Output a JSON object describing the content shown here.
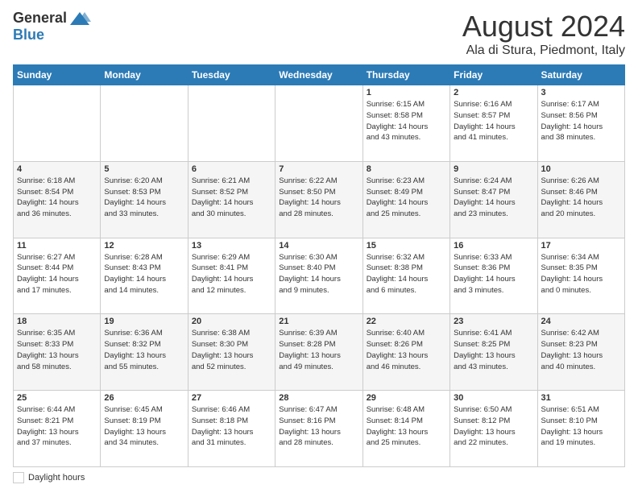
{
  "header": {
    "logo_general": "General",
    "logo_blue": "Blue",
    "month_title": "August 2024",
    "location": "Ala di Stura, Piedmont, Italy"
  },
  "calendar": {
    "headers": [
      "Sunday",
      "Monday",
      "Tuesday",
      "Wednesday",
      "Thursday",
      "Friday",
      "Saturday"
    ],
    "weeks": [
      [
        {
          "day": "",
          "info": ""
        },
        {
          "day": "",
          "info": ""
        },
        {
          "day": "",
          "info": ""
        },
        {
          "day": "",
          "info": ""
        },
        {
          "day": "1",
          "info": "Sunrise: 6:15 AM\nSunset: 8:58 PM\nDaylight: 14 hours\nand 43 minutes."
        },
        {
          "day": "2",
          "info": "Sunrise: 6:16 AM\nSunset: 8:57 PM\nDaylight: 14 hours\nand 41 minutes."
        },
        {
          "day": "3",
          "info": "Sunrise: 6:17 AM\nSunset: 8:56 PM\nDaylight: 14 hours\nand 38 minutes."
        }
      ],
      [
        {
          "day": "4",
          "info": "Sunrise: 6:18 AM\nSunset: 8:54 PM\nDaylight: 14 hours\nand 36 minutes."
        },
        {
          "day": "5",
          "info": "Sunrise: 6:20 AM\nSunset: 8:53 PM\nDaylight: 14 hours\nand 33 minutes."
        },
        {
          "day": "6",
          "info": "Sunrise: 6:21 AM\nSunset: 8:52 PM\nDaylight: 14 hours\nand 30 minutes."
        },
        {
          "day": "7",
          "info": "Sunrise: 6:22 AM\nSunset: 8:50 PM\nDaylight: 14 hours\nand 28 minutes."
        },
        {
          "day": "8",
          "info": "Sunrise: 6:23 AM\nSunset: 8:49 PM\nDaylight: 14 hours\nand 25 minutes."
        },
        {
          "day": "9",
          "info": "Sunrise: 6:24 AM\nSunset: 8:47 PM\nDaylight: 14 hours\nand 23 minutes."
        },
        {
          "day": "10",
          "info": "Sunrise: 6:26 AM\nSunset: 8:46 PM\nDaylight: 14 hours\nand 20 minutes."
        }
      ],
      [
        {
          "day": "11",
          "info": "Sunrise: 6:27 AM\nSunset: 8:44 PM\nDaylight: 14 hours\nand 17 minutes."
        },
        {
          "day": "12",
          "info": "Sunrise: 6:28 AM\nSunset: 8:43 PM\nDaylight: 14 hours\nand 14 minutes."
        },
        {
          "day": "13",
          "info": "Sunrise: 6:29 AM\nSunset: 8:41 PM\nDaylight: 14 hours\nand 12 minutes."
        },
        {
          "day": "14",
          "info": "Sunrise: 6:30 AM\nSunset: 8:40 PM\nDaylight: 14 hours\nand 9 minutes."
        },
        {
          "day": "15",
          "info": "Sunrise: 6:32 AM\nSunset: 8:38 PM\nDaylight: 14 hours\nand 6 minutes."
        },
        {
          "day": "16",
          "info": "Sunrise: 6:33 AM\nSunset: 8:36 PM\nDaylight: 14 hours\nand 3 minutes."
        },
        {
          "day": "17",
          "info": "Sunrise: 6:34 AM\nSunset: 8:35 PM\nDaylight: 14 hours\nand 0 minutes."
        }
      ],
      [
        {
          "day": "18",
          "info": "Sunrise: 6:35 AM\nSunset: 8:33 PM\nDaylight: 13 hours\nand 58 minutes."
        },
        {
          "day": "19",
          "info": "Sunrise: 6:36 AM\nSunset: 8:32 PM\nDaylight: 13 hours\nand 55 minutes."
        },
        {
          "day": "20",
          "info": "Sunrise: 6:38 AM\nSunset: 8:30 PM\nDaylight: 13 hours\nand 52 minutes."
        },
        {
          "day": "21",
          "info": "Sunrise: 6:39 AM\nSunset: 8:28 PM\nDaylight: 13 hours\nand 49 minutes."
        },
        {
          "day": "22",
          "info": "Sunrise: 6:40 AM\nSunset: 8:26 PM\nDaylight: 13 hours\nand 46 minutes."
        },
        {
          "day": "23",
          "info": "Sunrise: 6:41 AM\nSunset: 8:25 PM\nDaylight: 13 hours\nand 43 minutes."
        },
        {
          "day": "24",
          "info": "Sunrise: 6:42 AM\nSunset: 8:23 PM\nDaylight: 13 hours\nand 40 minutes."
        }
      ],
      [
        {
          "day": "25",
          "info": "Sunrise: 6:44 AM\nSunset: 8:21 PM\nDaylight: 13 hours\nand 37 minutes."
        },
        {
          "day": "26",
          "info": "Sunrise: 6:45 AM\nSunset: 8:19 PM\nDaylight: 13 hours\nand 34 minutes."
        },
        {
          "day": "27",
          "info": "Sunrise: 6:46 AM\nSunset: 8:18 PM\nDaylight: 13 hours\nand 31 minutes."
        },
        {
          "day": "28",
          "info": "Sunrise: 6:47 AM\nSunset: 8:16 PM\nDaylight: 13 hours\nand 28 minutes."
        },
        {
          "day": "29",
          "info": "Sunrise: 6:48 AM\nSunset: 8:14 PM\nDaylight: 13 hours\nand 25 minutes."
        },
        {
          "day": "30",
          "info": "Sunrise: 6:50 AM\nSunset: 8:12 PM\nDaylight: 13 hours\nand 22 minutes."
        },
        {
          "day": "31",
          "info": "Sunrise: 6:51 AM\nSunset: 8:10 PM\nDaylight: 13 hours\nand 19 minutes."
        }
      ]
    ]
  },
  "legend": {
    "label": "Daylight hours"
  }
}
